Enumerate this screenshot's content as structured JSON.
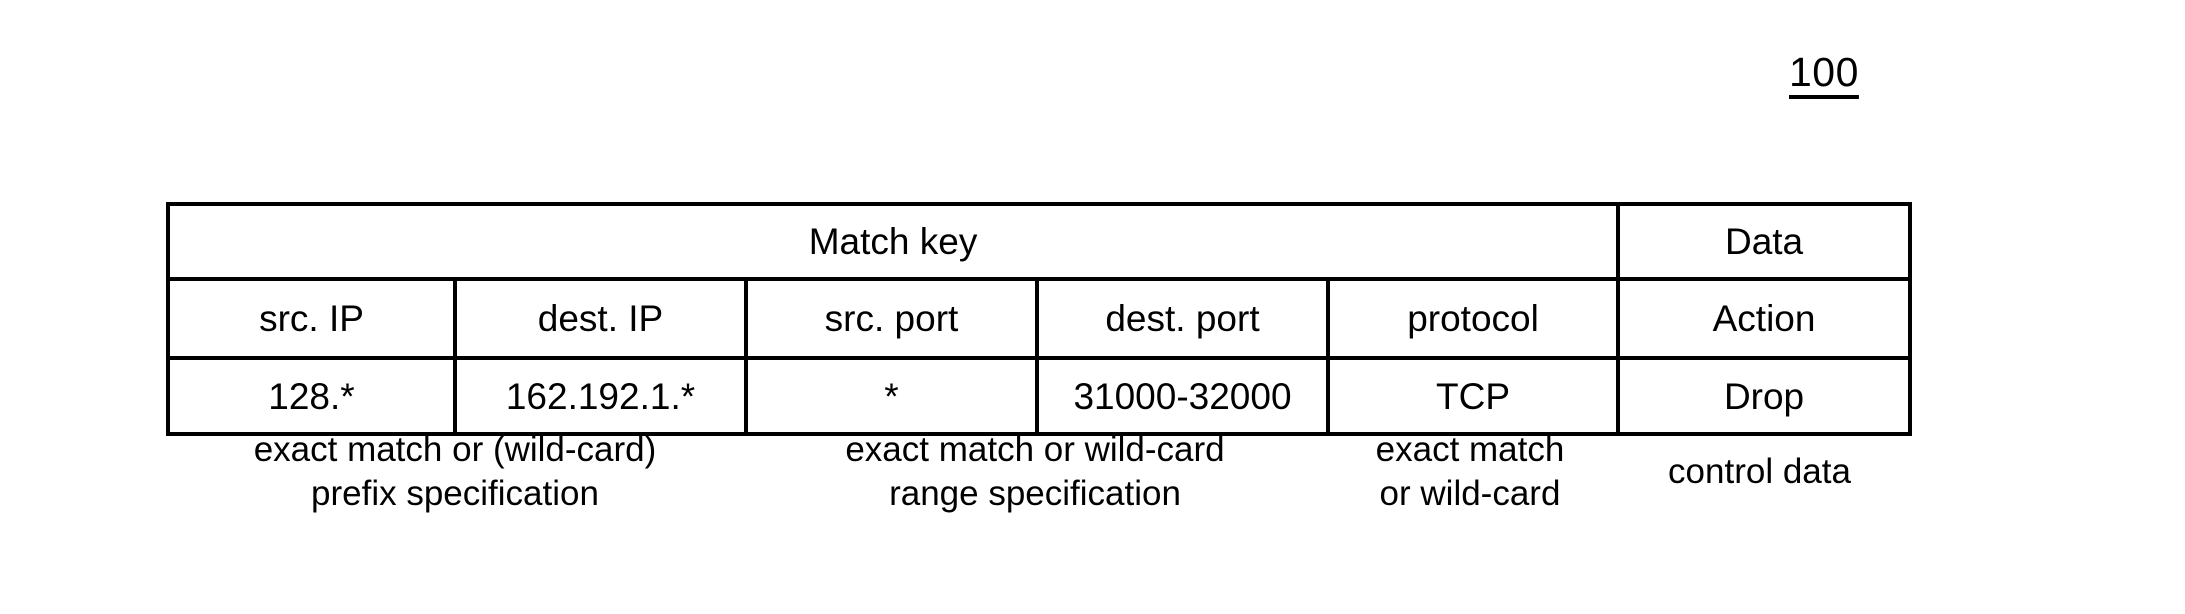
{
  "figure": {
    "number": "100"
  },
  "table": {
    "group_headers": [
      {
        "label": "Match key",
        "span": 5
      },
      {
        "label": "Data",
        "span": 1
      }
    ],
    "column_headers": [
      "src. IP",
      "dest. IP",
      "src. port",
      "dest. port",
      "protocol",
      "Action"
    ],
    "rows": [
      [
        "128.*",
        "162.192.1.*",
        "*",
        "31000-32000",
        "TCP",
        "Drop"
      ]
    ]
  },
  "captions": [
    {
      "line1": "exact match or (wild-card)",
      "line2": "prefix specification"
    },
    {
      "line1": "exact match or wild-card",
      "line2": "range specification"
    },
    {
      "line1": "exact match",
      "line2": "or wild-card"
    },
    {
      "line1": "control data",
      "line2": ""
    }
  ],
  "colors": {
    "background": "#ffffff",
    "foreground": "#000000",
    "border": "#000000"
  }
}
